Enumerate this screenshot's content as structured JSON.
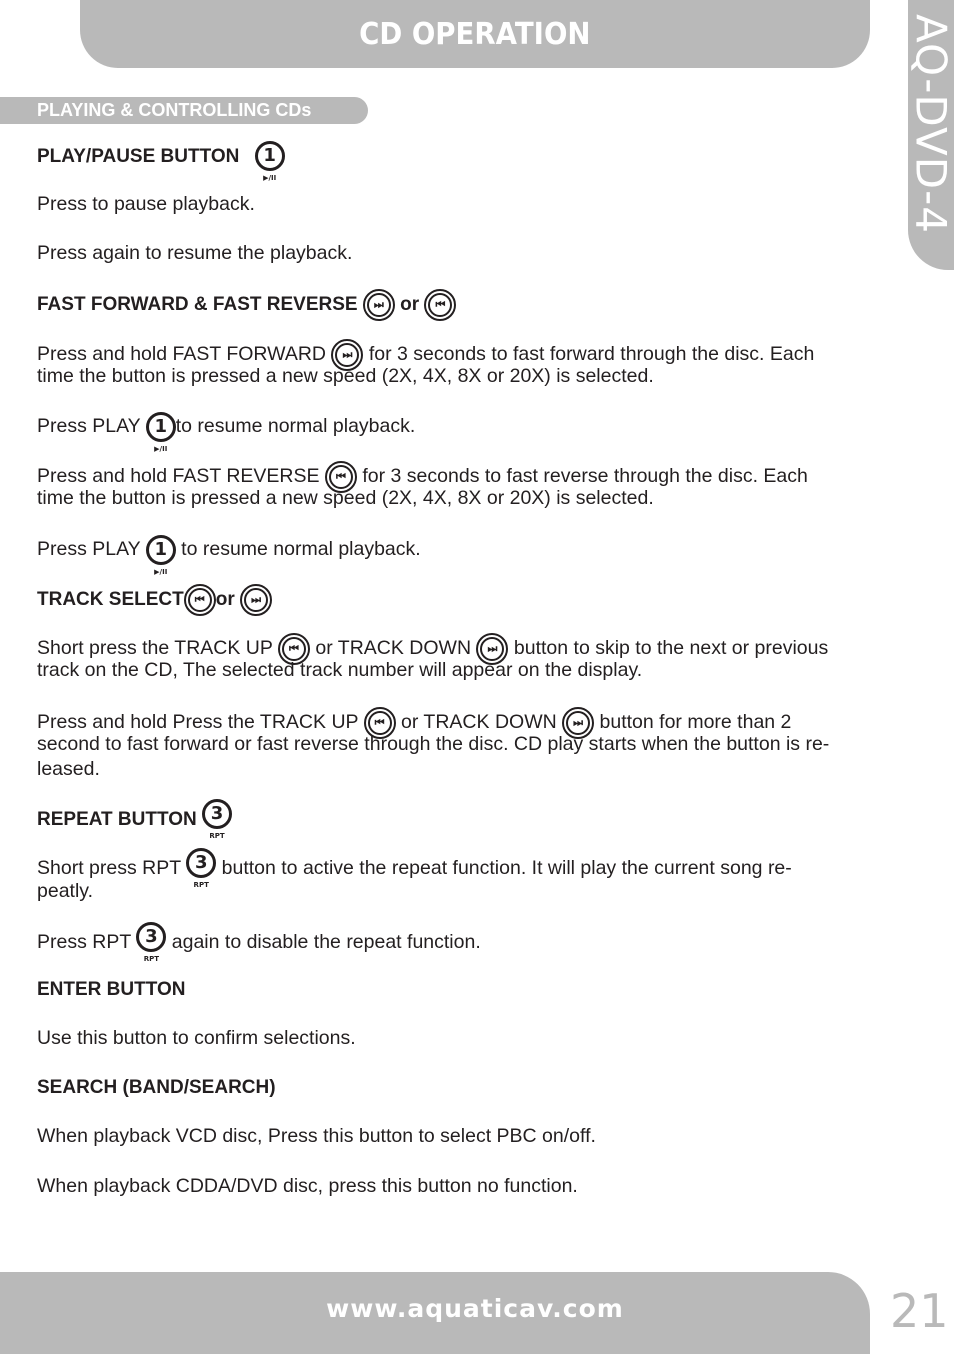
{
  "header": {
    "title": "CD OPERATION"
  },
  "side_tab": {
    "model": "AQ-DVD-4"
  },
  "section": {
    "title": "PLAYING & CONTROLLING CDs"
  },
  "icons": {
    "play_pause": {
      "number": "1",
      "sub": "▶/II",
      "name": "play-pause-icon"
    },
    "rpt": {
      "number": "3",
      "sub": "RPT",
      "name": "repeat-icon"
    },
    "next_glyph": "⏭",
    "prev_glyph": "⏮"
  },
  "content": {
    "play_pause": {
      "heading": "PLAY/PAUSE BUTTON",
      "p1": "Press to pause playback.",
      "p2": "Press again to resume the playback."
    },
    "fast": {
      "heading": "FAST FORWARD & FAST REVERSE",
      "or": "or",
      "ff_a": "Press and hold FAST FORWARD",
      "ff_b": "for 3 seconds to fast forward through the disc. Each",
      "ff_c": "time the button is pressed a new speed (2X, 4X, 8X or 20X) is selected.",
      "play1_a": "Press PLAY",
      "play1_b": "to resume normal playback.",
      "fr_a": "Press and hold FAST REVERSE",
      "fr_b": "for 3 seconds to fast reverse through the disc. Each",
      "fr_c": "time the button is pressed a new speed (2X, 4X, 8X or 20X) is selected.",
      "play2_a": "Press PLAY",
      "play2_b": "to resume normal playback."
    },
    "track": {
      "heading": "TRACK SELECT",
      "or": "or",
      "s1_a": "Short press the TRACK UP",
      "s1_b": "or TRACK DOWN",
      "s1_c": "button to skip to the next or previous",
      "s1_d": "track on the CD, The selected track number will appear on the display.",
      "s2_a": "Press and hold Press the TRACK UP",
      "s2_b": "or TRACK DOWN",
      "s2_c": "button for more than 2",
      "s2_d": "second to fast forward or fast reverse through the disc. CD play starts when the button is re-",
      "s2_e": "leased."
    },
    "repeat": {
      "heading": "REPEAT BUTTON",
      "r1_a": "Short press RPT",
      "r1_b": "button to active the repeat function. It will play the current song re-",
      "r1_c": "peatly.",
      "r2_a": "Press RPT",
      "r2_b": "again to disable the repeat function."
    },
    "enter": {
      "heading": "ENTER BUTTON",
      "p1": "Use this button to confirm selections."
    },
    "search": {
      "heading": "SEARCH (BAND/SEARCH)",
      "p1": "When playback VCD disc, Press this button to select PBC on/off.",
      "p2": "When playback CDDA/DVD disc, press this button no function."
    }
  },
  "footer": {
    "url": "www.aquaticav.com",
    "page_number": "21"
  }
}
